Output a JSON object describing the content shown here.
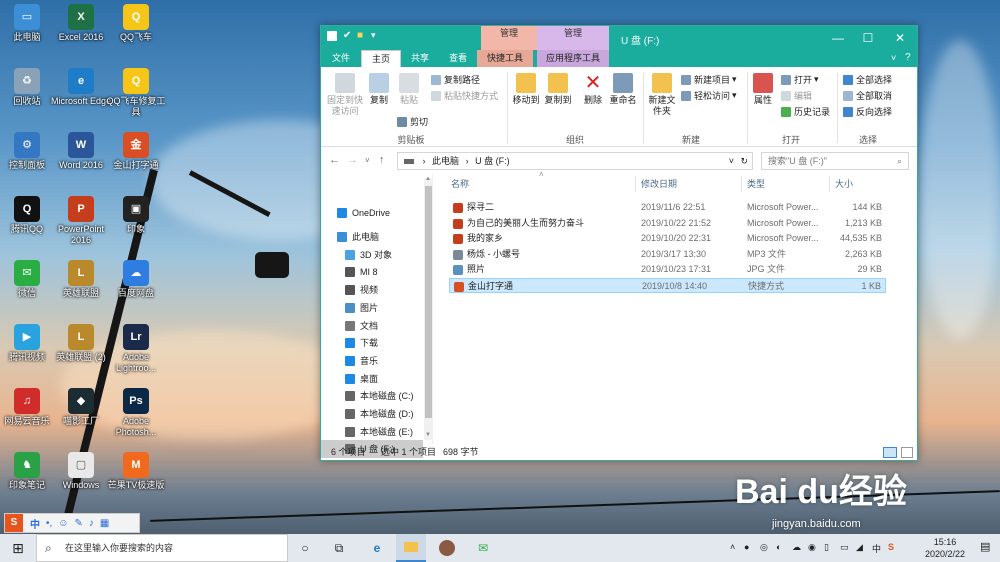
{
  "desktop": {
    "icons": [
      {
        "label": "此电脑",
        "color": "#3c8fd6",
        "glyph": "▭"
      },
      {
        "label": "Excel 2016",
        "color": "#1e7145",
        "glyph": "X"
      },
      {
        "label": "QQ飞车",
        "color": "#f5c518",
        "glyph": "Q"
      },
      {
        "label": "回收站",
        "color": "#8aa2b8",
        "glyph": "♻"
      },
      {
        "label": "Microsoft Edge",
        "color": "#1f7cc7",
        "glyph": "e"
      },
      {
        "label": "QQ飞车修复工具",
        "color": "#f5c518",
        "glyph": "Q"
      },
      {
        "label": "控制面板",
        "color": "#3477c3",
        "glyph": "⚙"
      },
      {
        "label": "Word 2016",
        "color": "#2b579a",
        "glyph": "W"
      },
      {
        "label": "金山打字通",
        "color": "#d94f23",
        "glyph": "金"
      },
      {
        "label": "腾讯QQ",
        "color": "#111111",
        "glyph": "Q"
      },
      {
        "label": "PowerPoint 2016",
        "color": "#c43e1c",
        "glyph": "P"
      },
      {
        "label": "印象",
        "color": "#222222",
        "glyph": "▣"
      },
      {
        "label": "微信",
        "color": "#2aae43",
        "glyph": "✉"
      },
      {
        "label": "英雄联盟",
        "color": "#b9892b",
        "glyph": "L"
      },
      {
        "label": "百度网盘",
        "color": "#2f7de1",
        "glyph": "☁"
      },
      {
        "label": "腾讯视频",
        "color": "#29a3e0",
        "glyph": "▶"
      },
      {
        "label": "英雄联盟 (2)",
        "color": "#b9892b",
        "glyph": "L"
      },
      {
        "label": "Adobe Lightroo...",
        "color": "#1b2a4a",
        "glyph": "Lr"
      },
      {
        "label": "网易云音乐",
        "color": "#d12c2c",
        "glyph": "♫"
      },
      {
        "label": "喵影工厂",
        "color": "#1c2c33",
        "glyph": "◆"
      },
      {
        "label": "Adobe Photosh...",
        "color": "#0b2847",
        "glyph": "Ps"
      },
      {
        "label": "印象笔记",
        "color": "#2aa146",
        "glyph": "♞"
      },
      {
        "label": "Windows",
        "color": "#e9e9e9",
        "glyph": "▢"
      },
      {
        "label": "芒果TV极速版",
        "color": "#ef6a1c",
        "glyph": "M"
      }
    ]
  },
  "window": {
    "quick_access": [
      "▬",
      "✔",
      "■",
      "▾"
    ],
    "context_tab_1": "管理",
    "context_tab_2": "管理",
    "title": "U 盘 (F:)",
    "controls": {
      "minimize": "—",
      "maximize": "☐",
      "close": "✕"
    },
    "tabs": [
      "文件",
      "主页",
      "共享",
      "查看",
      "快捷工具",
      "应用程序工具"
    ],
    "ribbon": {
      "clipboard": {
        "pin": "固定到快速访问",
        "copy": "复制",
        "paste": "粘贴",
        "copy_path": "复制路径",
        "paste_shortcut": "粘贴快捷方式",
        "cut": "剪切",
        "group": "剪贴板"
      },
      "organize": {
        "move_to": "移动到",
        "copy_to": "复制到",
        "delete": "删除",
        "rename": "重命名",
        "group": "组织"
      },
      "new": {
        "new_folder": "新建文件夹",
        "new_item": "新建项目",
        "easy_access": "轻松访问",
        "group": "新建"
      },
      "open": {
        "properties": "属性",
        "open": "打开",
        "edit": "编辑",
        "history": "历史记录",
        "group": "打开"
      },
      "select": {
        "select_all": "全部选择",
        "select_none": "全部取消",
        "invert": "反向选择",
        "group": "选择"
      }
    },
    "address": {
      "path_root": "此电脑",
      "path_current": "U 盘 (F:)",
      "search_placeholder": "搜索\"U 盘 (F:)\""
    },
    "nav": {
      "items": [
        {
          "label": "OneDrive",
          "color": "#1e88e5"
        },
        {
          "label": "此电脑",
          "color": "#3c8fd6"
        },
        {
          "label": "3D 对象",
          "color": "#4aa3df"
        },
        {
          "label": "MI 8",
          "color": "#555555"
        },
        {
          "label": "视频",
          "color": "#555555"
        },
        {
          "label": "图片",
          "color": "#4a90c7"
        },
        {
          "label": "文档",
          "color": "#777777"
        },
        {
          "label": "下载",
          "color": "#1e88e5"
        },
        {
          "label": "音乐",
          "color": "#1e88e5"
        },
        {
          "label": "桌面",
          "color": "#1e88e5"
        },
        {
          "label": "本地磁盘 (C:)",
          "color": "#666666"
        },
        {
          "label": "本地磁盘 (D:)",
          "color": "#666666"
        },
        {
          "label": "本地磁盘 (E:)",
          "color": "#666666"
        },
        {
          "label": "U 盘 (F:)",
          "color": "#666666"
        }
      ]
    },
    "columns": {
      "name": "名称",
      "modified": "修改日期",
      "type": "类型",
      "size": "大小"
    },
    "files": [
      {
        "name": "探寻二",
        "modified": "2019/11/6 22:51",
        "type": "Microsoft Power...",
        "size": "144 KB",
        "color": "#c43e1c"
      },
      {
        "name": "为自己的美丽人生而努力奋斗",
        "modified": "2019/10/22 21:52",
        "type": "Microsoft Power...",
        "size": "1,213 KB",
        "color": "#c43e1c"
      },
      {
        "name": "我的家乡",
        "modified": "2019/10/20 22:31",
        "type": "Microsoft Power...",
        "size": "44,535 KB",
        "color": "#c43e1c"
      },
      {
        "name": "杨烁 - 小螺号",
        "modified": "2019/3/17 13:30",
        "type": "MP3 文件",
        "size": "2,263 KB",
        "color": "#7a8a9a"
      },
      {
        "name": "照片",
        "modified": "2019/10/23 17:31",
        "type": "JPG 文件",
        "size": "29 KB",
        "color": "#5a8fbf"
      },
      {
        "name": "金山打字通",
        "modified": "2019/10/8 14:40",
        "type": "快捷方式",
        "size": "1 KB",
        "color": "#d94f23"
      }
    ],
    "status": {
      "count": "6 个项目",
      "selected": "选中 1 个项目",
      "size": "698 字节"
    }
  },
  "taskbar": {
    "search_placeholder": "在这里输入你要搜索的内容",
    "time": "15:16",
    "date": "2020/2/22",
    "ime_char": "中",
    "tray_lang": "中"
  },
  "watermark": {
    "logo": "Bai du经验",
    "url": "jingyan.baidu.com"
  }
}
